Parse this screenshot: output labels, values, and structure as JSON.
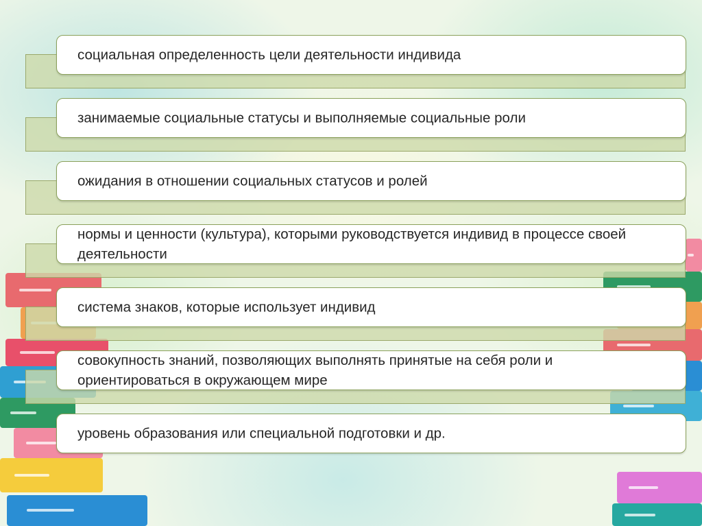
{
  "items": [
    {
      "text": "социальная определенность цели деятельности индивида"
    },
    {
      "text": "занимаемые социальные статусы и выполняемые социальные роли"
    },
    {
      "text": "ожидания в отношении социальных статусов и ролей"
    },
    {
      "text": "нормы и ценности (культура), которыми руководствуется индивид в процессе своей деятельности"
    },
    {
      "text": "система знаков, которые использует индивид"
    },
    {
      "text": "совокупность знаний, позволяющих выполнять принятые на себя роли и ориентироваться в окружающем мире"
    },
    {
      "text": "уровень образования или специальной подготовки и др."
    }
  ],
  "colors": {
    "card_border": "#8aa05a",
    "bar_fill": "#cddaaa",
    "text": "#262626"
  }
}
